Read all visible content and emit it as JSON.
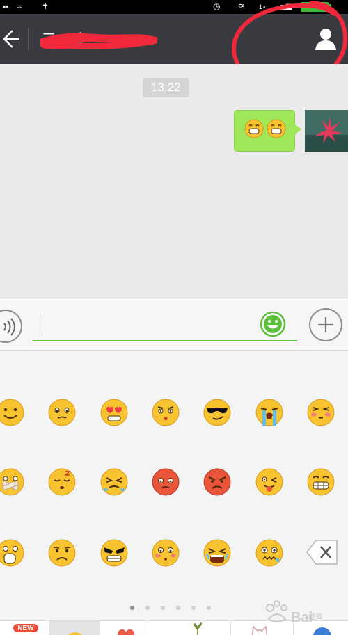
{
  "status_bar": {
    "signal_text": "1×"
  },
  "nav": {
    "title": "三一 小",
    "back_icon": "back-arrow-icon",
    "profile_icon": "person-icon"
  },
  "chat": {
    "timestamp": "13:22",
    "messages": [
      {
        "sender": "me",
        "content": "😁😁",
        "bubble_color": "#9fe658"
      }
    ]
  },
  "input_bar": {
    "text_value": "",
    "voice_icon": "voice-icon",
    "emoji_icon": "smiley-icon",
    "plus_icon": "plus-icon"
  },
  "emoji_panel": {
    "rows": [
      [
        "smile",
        "blush-shy",
        "heart-eyes",
        "awkward-sweat",
        "cool-sunglasses",
        "cry-loud",
        "shy-blush"
      ],
      [
        "silent-taped",
        "sleepy",
        "angry-puff",
        "embarrassed-red",
        "furious",
        "wink-tongue",
        "grin-teeth"
      ],
      [
        "surprised",
        "sad-frown",
        "evil-grin",
        "timid-blush",
        "bawling",
        "distressed"
      ]
    ],
    "delete_icon": "backspace-icon",
    "pages": 6,
    "current_page": 1
  },
  "tabs": {
    "new_badge": "NEW",
    "items": [
      "emoji-store-tab",
      "default-emoji-tab",
      "favorites-tab",
      "sticker-pack-1-tab",
      "sticker-pack-2-tab",
      "sticker-pack-3-tab",
      "sticker-pack-4-tab"
    ],
    "selected": 1
  },
  "watermark": {
    "text": "Bai",
    "sub": "经验"
  },
  "colors": {
    "nav_bg": "#393a3f",
    "chat_bg": "#ebebeb",
    "bubble": "#9fe658",
    "accent_green": "#5cbf3c",
    "badge_red": "#f24a3a",
    "annotation_red": "#f0283c"
  }
}
